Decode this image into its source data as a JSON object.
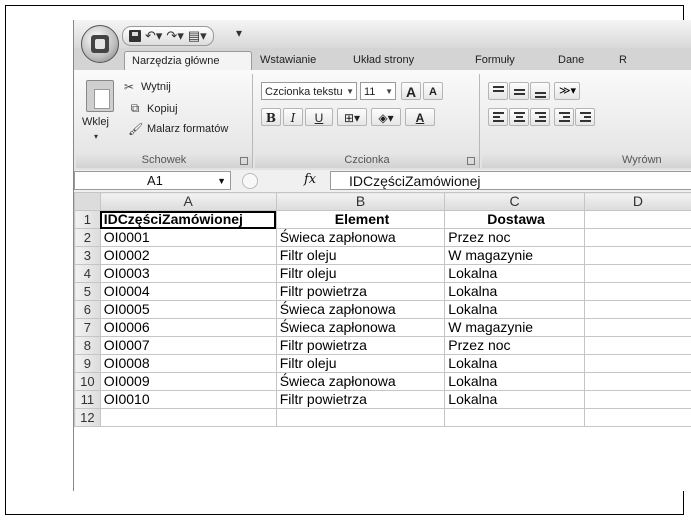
{
  "ribbon": {
    "tabs": [
      "Narzędzia główne",
      "Wstawianie",
      "Układ strony",
      "Formuły",
      "Dane",
      "R"
    ],
    "active_tab": "Narzędzia główne",
    "clipboard": {
      "paste_label": "Wklej",
      "cut_label": "Wytnij",
      "copy_label": "Kopiuj",
      "format_painter_label": "Malarz formatów",
      "group_label": "Schowek"
    },
    "font": {
      "font_name": "Czcionka tekstu",
      "font_size": "11",
      "grow_label": "A",
      "shrink_label": "A",
      "bold_label": "B",
      "italic_label": "I",
      "underline_label": "U",
      "font_color_label": "A",
      "group_label": "Czcionka"
    },
    "alignment": {
      "group_label": "Wyrówn"
    }
  },
  "formula_bar": {
    "name_box": "A1",
    "fx_label": "fx",
    "value": "IDCzęściZamówionej"
  },
  "sheet": {
    "columns": [
      "A",
      "B",
      "C",
      "D"
    ],
    "rows": [
      {
        "num": "1",
        "cells": [
          "IDCzęściZamówionej",
          "Element",
          "Dostawa",
          ""
        ]
      },
      {
        "num": "2",
        "cells": [
          "OI0001",
          "Świeca zapłonowa",
          "Przez noc",
          ""
        ]
      },
      {
        "num": "3",
        "cells": [
          "OI0002",
          "Filtr oleju",
          "W magazynie",
          ""
        ]
      },
      {
        "num": "4",
        "cells": [
          "OI0003",
          "Filtr oleju",
          "Lokalna",
          ""
        ]
      },
      {
        "num": "5",
        "cells": [
          "OI0004",
          "Filtr powietrza",
          "Lokalna",
          ""
        ]
      },
      {
        "num": "6",
        "cells": [
          "OI0005",
          "Świeca zapłonowa",
          "Lokalna",
          ""
        ]
      },
      {
        "num": "7",
        "cells": [
          "OI0006",
          "Świeca zapłonowa",
          "W magazynie",
          ""
        ]
      },
      {
        "num": "8",
        "cells": [
          "OI0007",
          "Filtr powietrza",
          "Przez noc",
          ""
        ]
      },
      {
        "num": "9",
        "cells": [
          "OI0008",
          "Filtr oleju",
          "Lokalna",
          ""
        ]
      },
      {
        "num": "10",
        "cells": [
          "OI0009",
          "Świeca zapłonowa",
          "Lokalna",
          ""
        ]
      },
      {
        "num": "11",
        "cells": [
          "OI0010",
          "Filtr powietrza",
          "Lokalna",
          ""
        ]
      },
      {
        "num": "12",
        "cells": [
          "",
          "",
          "",
          ""
        ]
      }
    ]
  }
}
